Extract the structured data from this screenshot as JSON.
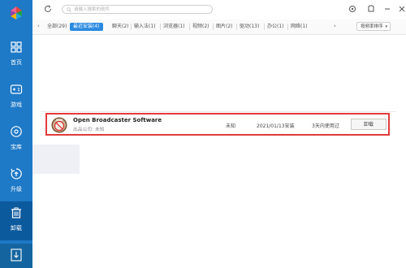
{
  "sidebar": {
    "items": [
      {
        "label": "首页"
      },
      {
        "label": "游戏"
      },
      {
        "label": "宝库"
      },
      {
        "label": "升级"
      },
      {
        "label": "卸载"
      }
    ]
  },
  "topbar": {
    "search_placeholder": "请输入搜索的软件"
  },
  "tabs": [
    {
      "label": "全部(29)"
    },
    {
      "label": "最近安装(4)"
    },
    {
      "label": "聊天(2)"
    },
    {
      "label": "输入法(1)"
    },
    {
      "label": "浏览器(1)"
    },
    {
      "label": "视频(2)"
    },
    {
      "label": "图片(2)"
    },
    {
      "label": "驱动(13)"
    },
    {
      "label": "办公(1)"
    },
    {
      "label": "网络(1)"
    }
  ],
  "sort_label": "按频率排序",
  "app_row": {
    "name": "Open Broadcaster Software",
    "publisher": "出品公司: 未知",
    "size": "未知",
    "install_date": "2021/01/13安装",
    "usage": "3天内使用过",
    "uninstall_label": "卸载"
  },
  "colors": {
    "sidebar": "#1e79c6",
    "active_tab": "#2a8ae0",
    "highlight_border": "#e23b3b"
  }
}
